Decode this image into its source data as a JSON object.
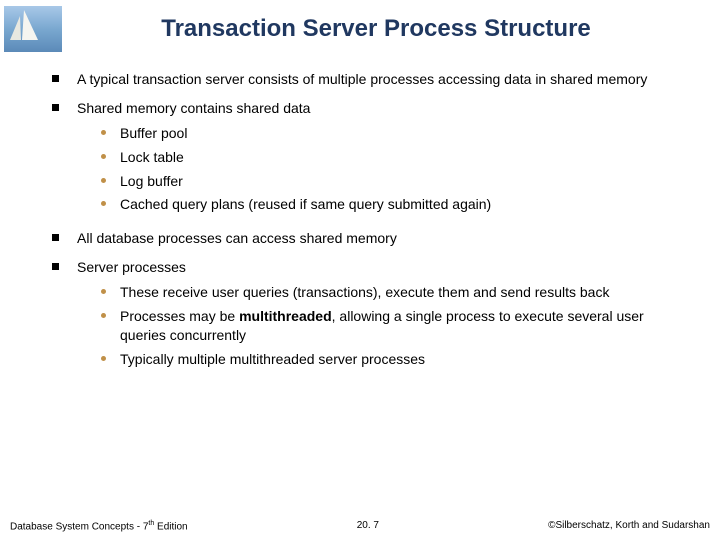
{
  "slide": {
    "title": "Transaction Server Process Structure",
    "bullets": [
      {
        "text": "A typical transaction server consists of multiple processes accessing data in shared memory",
        "sub": []
      },
      {
        "text": "Shared memory contains shared data",
        "sub": [
          "Buffer pool",
          "Lock table",
          "Log buffer",
          "Cached query plans (reused if same query submitted again)"
        ]
      },
      {
        "text": "All database processes can access shared memory",
        "sub": []
      },
      {
        "text": "Server processes",
        "sub": [
          "These receive user queries (transactions), execute them and send results back",
          {
            "html": "Processes may be <b>multithreaded</b>, allowing a single process to execute several user queries concurrently"
          },
          "Typically multiple multithreaded server processes"
        ]
      }
    ]
  },
  "footer": {
    "left_prefix": "Database System Concepts - 7",
    "left_sup": "th",
    "left_suffix": " Edition",
    "center": "20. 7",
    "right": "©Silberschatz, Korth and Sudarshan"
  }
}
